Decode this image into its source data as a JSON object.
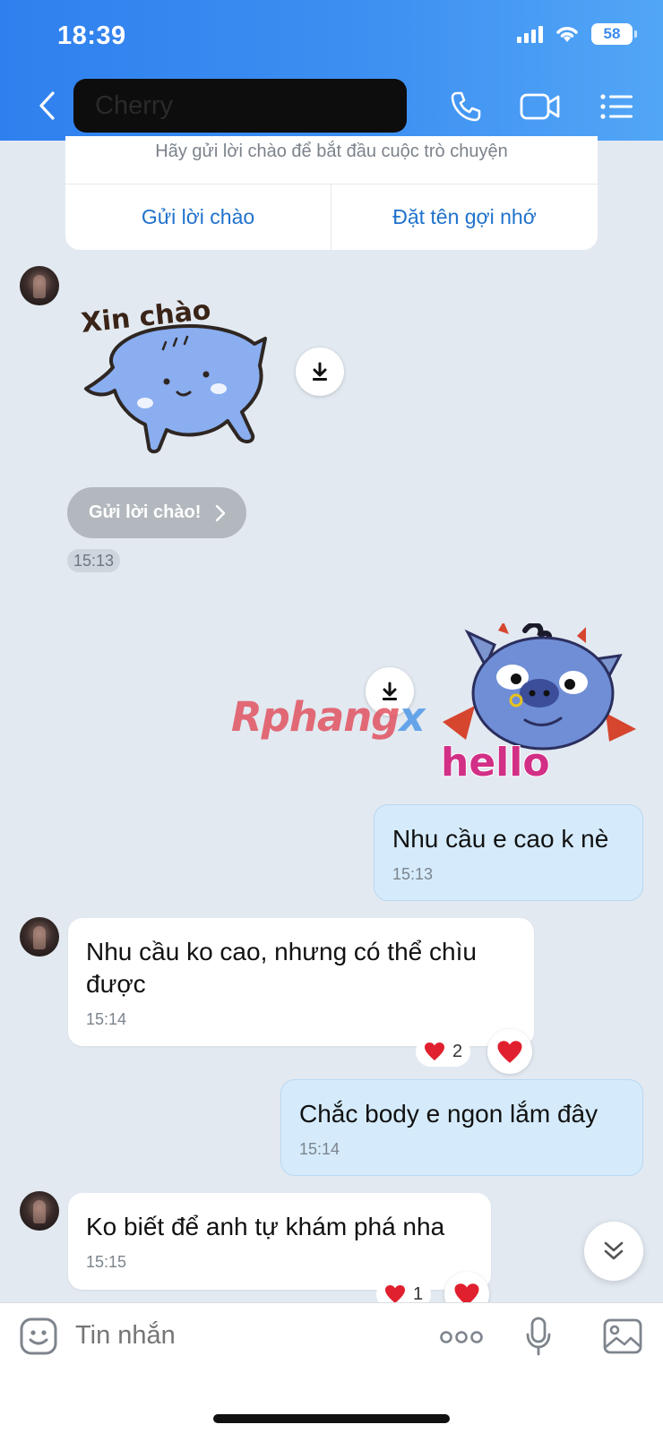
{
  "status_bar": {
    "time": "18:39",
    "battery": "58"
  },
  "header": {
    "contact_name": "Cherry"
  },
  "greeting_card": {
    "hint": "Hãy gửi lời chào để bắt đầu cuộc trò chuyện",
    "send_greeting_label": "Gửi lời chào",
    "set_nickname_label": "Đặt tên gợi nhớ"
  },
  "stickers": {
    "xin_chao_caption": "Xin chào",
    "hello_caption": "hello"
  },
  "greeting_reply": {
    "button_label": "Gửi lời chào!",
    "time": "15:13"
  },
  "watermark": {
    "part1": "Rphang",
    "part2": "x"
  },
  "messages": [
    {
      "direction": "out",
      "text": "Nhu cầu e cao k nè",
      "time": "15:13"
    },
    {
      "direction": "in",
      "text": "Nhu cầu ko cao, nhưng có thể chìu được",
      "time": "15:14",
      "reaction_count": "2"
    },
    {
      "direction": "out",
      "text": "Chắc body e ngon lắm đây",
      "time": "15:14"
    },
    {
      "direction": "in",
      "text": "Ko biết để anh tự khám phá nha",
      "time": "15:15",
      "reaction_count": "1"
    }
  ],
  "composer": {
    "placeholder": "Tin nhắn"
  },
  "colors": {
    "header_blue": "#3b8cf0",
    "outgoing_bubble": "#d5ebfb",
    "chat_background": "#e2e9f1",
    "heart": "#e0202e",
    "link_blue": "#1f72cc"
  },
  "icons": [
    "chevron-left-icon",
    "phone-icon",
    "video-camera-icon",
    "menu-list-icon",
    "download-icon",
    "chevron-right-icon",
    "heart-icon",
    "double-chevron-down-icon",
    "emoji-icon",
    "more-dots-icon",
    "microphone-icon",
    "image-icon"
  ]
}
